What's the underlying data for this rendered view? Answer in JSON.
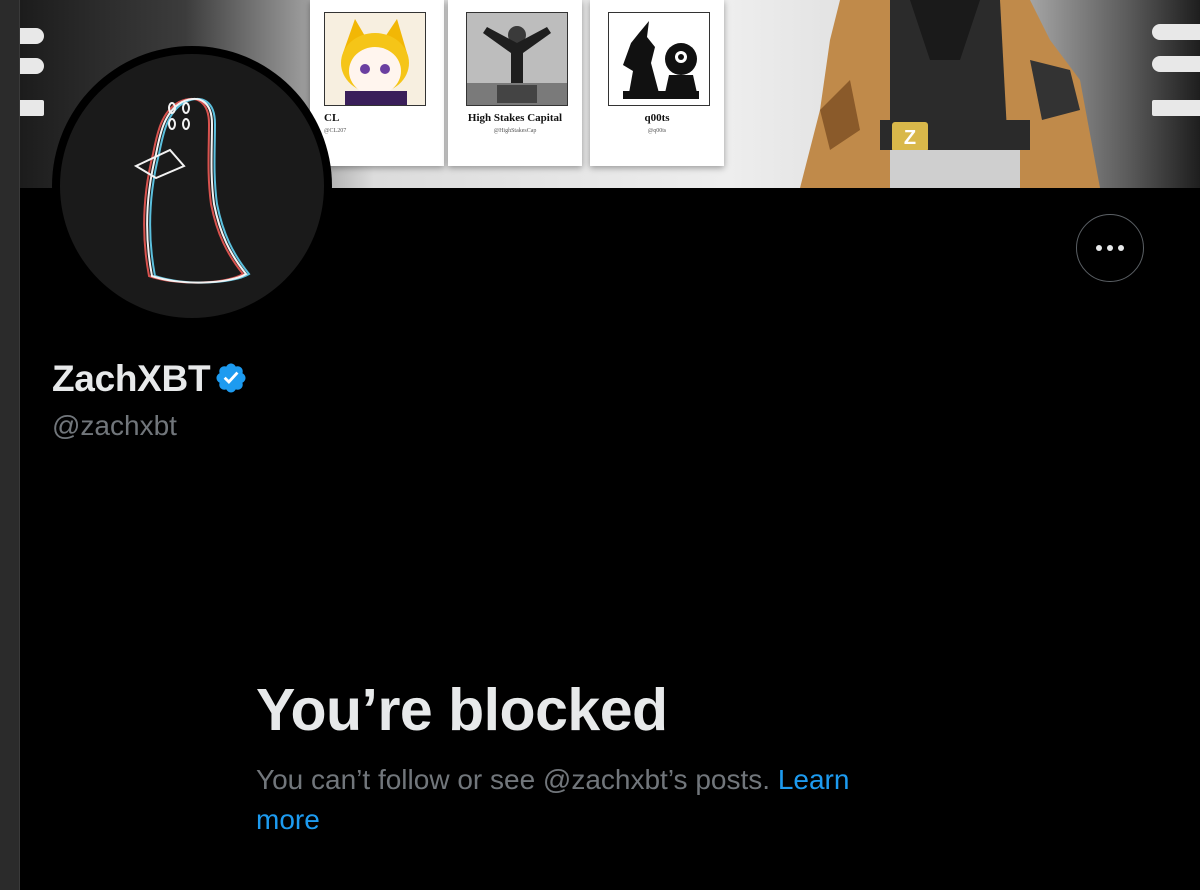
{
  "banner": {
    "cards": [
      {
        "name": "CL",
        "handle": "@CL207"
      },
      {
        "name": "High Stakes Capital",
        "handle": "@HighStakesCap"
      },
      {
        "name": "q00ts",
        "handle": "@q00ts"
      }
    ]
  },
  "profile": {
    "display_name": "ZachXBT",
    "handle": "@zachxbt",
    "verified": true,
    "more_icon": "more-horizontal-icon",
    "verified_icon": "verified-badge-icon"
  },
  "blocked": {
    "title": "You’re blocked",
    "message": "You can’t follow or see @zachxbt’s posts.",
    "link": "Learn more"
  },
  "colors": {
    "background": "#000000",
    "primary_text": "#e7e9ea",
    "secondary_text": "#71767b",
    "link": "#1d9bf0",
    "verified": "#1d9bf0"
  }
}
